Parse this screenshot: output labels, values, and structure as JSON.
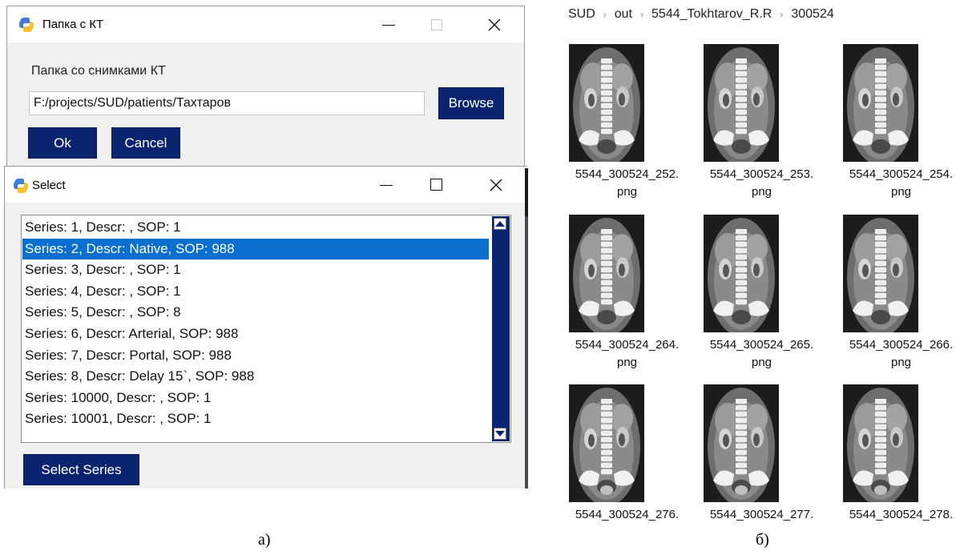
{
  "folder_dialog": {
    "title": "Папка с КТ",
    "label": "Папка со снимками КТ",
    "path_value": "F:/projects/SUD/patients/Тахтаров",
    "browse_label": "Browse",
    "ok_label": "Ok",
    "cancel_label": "Cancel"
  },
  "select_dialog": {
    "title": "Select",
    "series": [
      "Series: 1, Descr: , SOP: 1",
      "Series: 2, Descr: Native, SOP: 988",
      "Series: 3, Descr: , SOP: 1",
      "Series: 4, Descr: , SOP: 1",
      "Series: 5, Descr: , SOP: 8",
      "Series: 6, Descr: Arterial, SOP: 988",
      "Series: 7, Descr: Portal, SOP: 988",
      "Series: 8, Descr: Delay 15`, SOP: 988",
      "Series: 10000, Descr: , SOP: 1",
      "Series: 10001, Descr: , SOP: 1"
    ],
    "selected_index": 1,
    "select_button_label": "Select Series"
  },
  "explorer": {
    "breadcrumb": [
      "SUD",
      "out",
      "5544_Tokhtarov_R.R",
      "300524"
    ],
    "files": [
      {
        "name": "5544_300524_252.",
        "ext": "png"
      },
      {
        "name": "5544_300524_253.",
        "ext": "png"
      },
      {
        "name": "5544_300524_254.",
        "ext": "png"
      },
      {
        "name": "5544_300524_264.",
        "ext": "png"
      },
      {
        "name": "5544_300524_265.",
        "ext": "png"
      },
      {
        "name": "5544_300524_266.",
        "ext": "png"
      },
      {
        "name": "5544_300524_276.",
        "ext": ""
      },
      {
        "name": "5544_300524_277.",
        "ext": ""
      },
      {
        "name": "5544_300524_278.",
        "ext": ""
      }
    ]
  },
  "captions": {
    "a": "а)",
    "b": "б)"
  },
  "colors": {
    "button_bg": "#0b2470",
    "selection_bg": "#0a6fcf",
    "app_icon_blue": "#3f7ad6",
    "app_icon_yellow": "#f5c12e"
  },
  "icons": [
    "python-app-icon",
    "minimize-icon",
    "maximize-icon",
    "close-icon",
    "chevron-right-icon",
    "scroll-up-arrow-icon",
    "scroll-down-arrow-icon",
    "ct-scan-thumbnail"
  ]
}
